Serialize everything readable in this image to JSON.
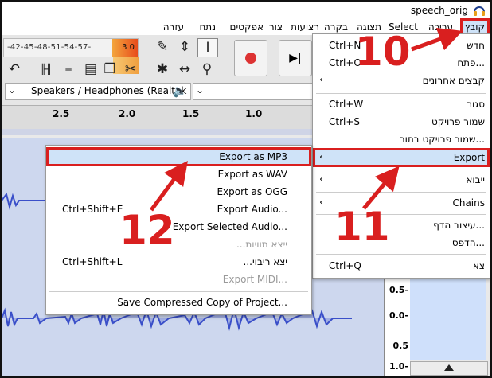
{
  "window": {
    "title": "speech_orig",
    "app_icon": "headphones-icon"
  },
  "menubar": {
    "items": [
      {
        "label": "קובץ",
        "active": true
      },
      {
        "label": "עריכה"
      },
      {
        "label": "Select"
      },
      {
        "label": "תצוגה"
      },
      {
        "label": "בקרה"
      },
      {
        "label": "רצועות"
      },
      {
        "label": "צור"
      },
      {
        "label": "אפקטים"
      },
      {
        "label": "נתח"
      },
      {
        "label": "עזרה"
      }
    ]
  },
  "toolbar": {
    "meter_scale": "-42-45-48-51-54-57-",
    "meter_hot": "3 0",
    "device": "Speakers / Headphones (Realtek"
  },
  "ruler": {
    "ticks": [
      "2.5",
      "2.0",
      "1.5",
      "1.0"
    ]
  },
  "scale": {
    "values": [
      "0.5-",
      "0.0-",
      "0.5",
      "1.0-"
    ]
  },
  "file_menu": {
    "items": [
      {
        "label": "חדש",
        "shortcut": "Ctrl+N"
      },
      {
        "label": "...פתח",
        "shortcut": "Ctrl+O"
      },
      {
        "label": "קבצים אחרונים",
        "submenu": true
      },
      {
        "label": "סגור",
        "shortcut": "Ctrl+W"
      },
      {
        "label": "שמור פרויקט",
        "shortcut": "Ctrl+S"
      },
      {
        "label": "...שמור פרויקט בתור"
      },
      {
        "label": "Export",
        "submenu": true,
        "highlighted": true
      },
      {
        "label": "ייבוא",
        "submenu": true
      },
      {
        "label": "Chains",
        "submenu": true
      },
      {
        "label": "...עיצוב הדף"
      },
      {
        "label": "...הדפס"
      },
      {
        "label": "צא",
        "shortcut": "Ctrl+Q"
      }
    ]
  },
  "export_menu": {
    "items": [
      {
        "label": "Export as MP3",
        "highlighted": true
      },
      {
        "label": "Export as WAV"
      },
      {
        "label": "Export as OGG"
      },
      {
        "label": "Export Audio...",
        "shortcut": "Ctrl+Shift+E"
      },
      {
        "label": "Export Selected Audio...",
        "shortcut": ""
      },
      {
        "label": "...ייצא תוויות",
        "disabled": true
      },
      {
        "label": "...יצא ריבוי",
        "shortcut": "Ctrl+Shift+L"
      },
      {
        "label": "Export MIDI...",
        "disabled": true
      },
      {
        "label": "Save Compressed Copy of Project..."
      }
    ]
  },
  "annotations": {
    "step1": "10",
    "step2": "11",
    "step3": "12",
    "color": "#d91f1f"
  }
}
